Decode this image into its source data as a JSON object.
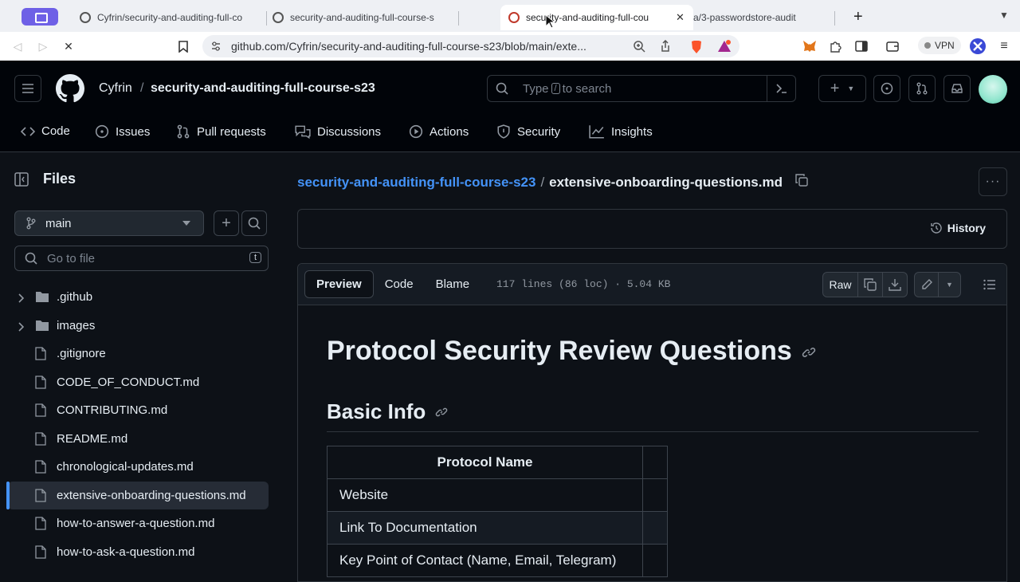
{
  "browser": {
    "tabs": [
      {
        "title": "Cyfrin/security-and-auditing-full-co"
      },
      {
        "title": "security-and-auditing-full-course-s"
      },
      {
        "title": "security-and-auditing-full-cou"
      },
      {
        "title": "a/3-passwordstore-audit"
      }
    ],
    "url": "github.com/Cyfrin/security-and-auditing-full-course-s23/blob/main/exte...",
    "vpn_label": "VPN"
  },
  "header": {
    "owner": "Cyfrin",
    "separator": "/",
    "repo": "security-and-auditing-full-course-s23",
    "search_prefix": "Type",
    "search_key": "/",
    "search_suffix": "to search"
  },
  "repo_nav": [
    {
      "label": "Code",
      "icon": "code-icon"
    },
    {
      "label": "Issues",
      "icon": "issue-icon"
    },
    {
      "label": "Pull requests",
      "icon": "pull-request-icon"
    },
    {
      "label": "Discussions",
      "icon": "discussion-icon"
    },
    {
      "label": "Actions",
      "icon": "play-icon"
    },
    {
      "label": "Security",
      "icon": "shield-icon"
    },
    {
      "label": "Insights",
      "icon": "graph-icon"
    }
  ],
  "sidebar": {
    "title": "Files",
    "branch": "main",
    "goto_placeholder": "Go to file",
    "goto_shortcut": "t",
    "items": [
      {
        "label": ".github",
        "type": "folder"
      },
      {
        "label": "images",
        "type": "folder"
      },
      {
        "label": ".gitignore",
        "type": "file"
      },
      {
        "label": "CODE_OF_CONDUCT.md",
        "type": "file"
      },
      {
        "label": "CONTRIBUTING.md",
        "type": "file"
      },
      {
        "label": "README.md",
        "type": "file"
      },
      {
        "label": "chronological-updates.md",
        "type": "file"
      },
      {
        "label": "extensive-onboarding-questions.md",
        "type": "file",
        "selected": true
      },
      {
        "label": "how-to-answer-a-question.md",
        "type": "file"
      },
      {
        "label": "how-to-ask-a-question.md",
        "type": "file"
      }
    ]
  },
  "main": {
    "breadcrumb_repo": "security-and-auditing-full-course-s23",
    "breadcrumb_sep": "/",
    "breadcrumb_file": "extensive-onboarding-questions.md",
    "history_label": "History",
    "view_tabs": [
      "Preview",
      "Code",
      "Blame"
    ],
    "file_meta": "117 lines (86 loc) · 5.04 KB",
    "raw_label": "Raw"
  },
  "document": {
    "h1": "Protocol Security Review Questions",
    "h2": "Basic Info",
    "table_header": "Protocol Name",
    "table_rows": [
      "Website",
      "Link To Documentation",
      "Key Point of Contact (Name, Email, Telegram)"
    ]
  },
  "colors": {
    "link": "#4493f8",
    "background": "#0d1117",
    "header_bg": "#010409"
  }
}
